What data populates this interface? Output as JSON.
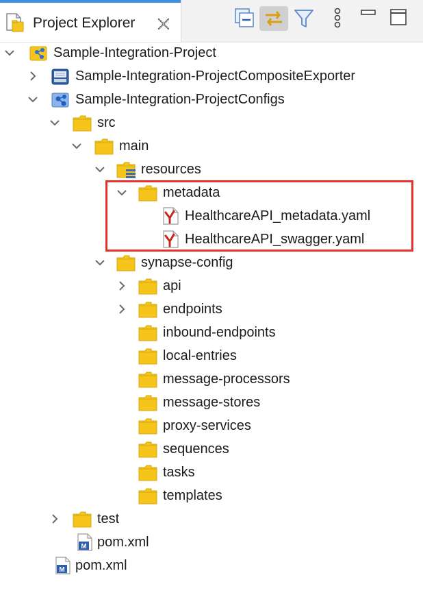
{
  "view": {
    "title": "Project Explorer",
    "icon": "project-explorer-icon",
    "toolbar": [
      "collapse-all-icon",
      "link-with-editor-icon",
      "filter-icon",
      "view-menu-icon",
      "minimize-icon",
      "maximize-icon"
    ]
  },
  "tree": [
    {
      "label": "Sample-Integration-Project",
      "icon": "integration-project-icon",
      "expanded": true
    },
    {
      "label": "Sample-Integration-ProjectCompositeExporter",
      "icon": "composite-exporter-icon",
      "expanded": false
    },
    {
      "label": "Sample-Integration-ProjectConfigs",
      "icon": "configs-project-icon",
      "expanded": true
    },
    {
      "label": "src",
      "icon": "folder-icon",
      "expanded": true
    },
    {
      "label": "main",
      "icon": "folder-icon",
      "expanded": true
    },
    {
      "label": "resources",
      "icon": "resource-folder-icon",
      "expanded": true
    },
    {
      "label": "metadata",
      "icon": "folder-icon",
      "expanded": true
    },
    {
      "label": "HealthcareAPI_metadata.yaml",
      "icon": "yaml-file-icon"
    },
    {
      "label": "HealthcareAPI_swagger.yaml",
      "icon": "yaml-file-icon"
    },
    {
      "label": "synapse-config",
      "icon": "folder-icon",
      "expanded": true
    },
    {
      "label": "api",
      "icon": "folder-icon",
      "expanded": false
    },
    {
      "label": "endpoints",
      "icon": "folder-icon",
      "expanded": false
    },
    {
      "label": "inbound-endpoints",
      "icon": "folder-icon"
    },
    {
      "label": "local-entries",
      "icon": "folder-icon"
    },
    {
      "label": "message-processors",
      "icon": "folder-icon"
    },
    {
      "label": "message-stores",
      "icon": "folder-icon"
    },
    {
      "label": "proxy-services",
      "icon": "folder-icon"
    },
    {
      "label": "sequences",
      "icon": "folder-icon"
    },
    {
      "label": "tasks",
      "icon": "folder-icon"
    },
    {
      "label": "templates",
      "icon": "folder-icon"
    },
    {
      "label": "test",
      "icon": "folder-icon",
      "expanded": false
    },
    {
      "label": "pom.xml",
      "icon": "maven-pom-icon"
    },
    {
      "label": "pom.xml",
      "icon": "maven-pom-icon"
    }
  ],
  "colors": {
    "folder": "#f5c51c",
    "highlight": "#e8312a",
    "active_tab": "#3d8fe0",
    "yaml": "#c8271c"
  }
}
